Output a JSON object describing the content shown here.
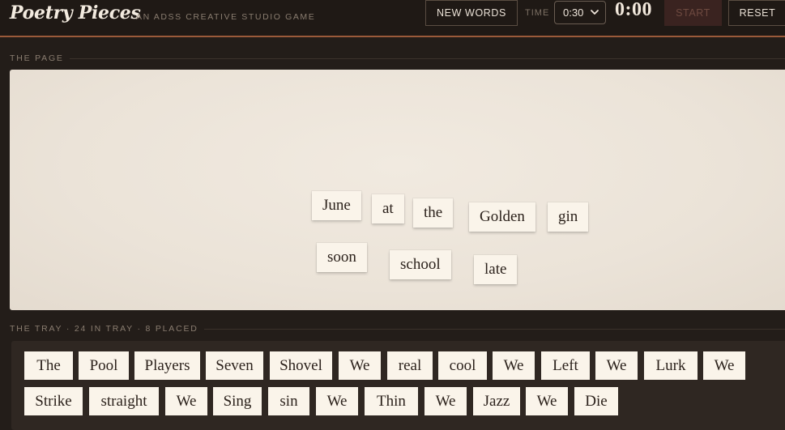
{
  "header": {
    "brand": "Poetry Pieces",
    "tagline": "AN ADSS CREATIVE STUDIO GAME",
    "new_words_label": "NEW WORDS",
    "time_label": "TIME",
    "time_value": "0:30",
    "timer": "0:00",
    "start_label": "START",
    "reset_label": "RESET"
  },
  "page": {
    "label": "THE PAGE"
  },
  "placed_words": [
    "June",
    "at",
    "the",
    "Golden",
    "gin",
    "soon",
    "school",
    "late"
  ],
  "tray": {
    "label": "THE TRAY ·  24 IN TRAY · 8 PLACED",
    "words": [
      "The",
      "Pool",
      "Players",
      "Seven",
      "Shovel",
      "We",
      "real",
      "cool",
      "We",
      "Left",
      "We",
      "Lurk",
      "We",
      "Strike",
      "straight",
      "We",
      "Sing",
      "sin",
      "We",
      "Thin",
      "We",
      "Jazz",
      "We",
      "Die"
    ]
  }
}
